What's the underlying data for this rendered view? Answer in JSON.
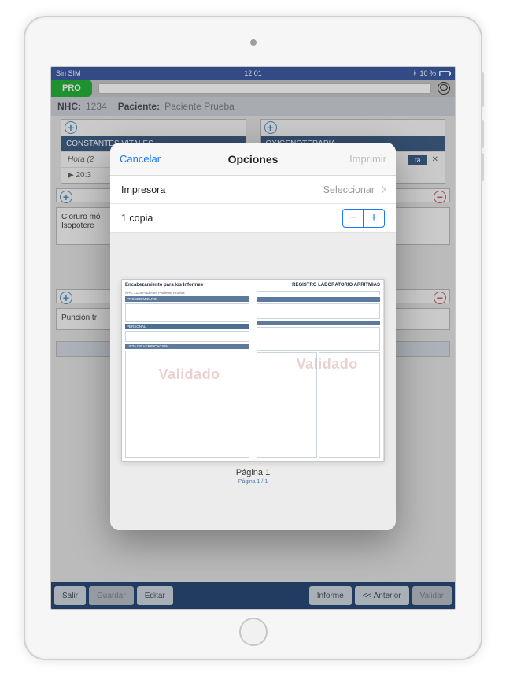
{
  "status": {
    "carrier": "Sin SIM",
    "time": "12:01",
    "battery_pct": "10 %"
  },
  "toolbar": {
    "pro": "PRO"
  },
  "patient": {
    "nhc_label": "NHC:",
    "nhc": "1234",
    "pac_label": "Paciente:",
    "pac": "Paciente Prueba"
  },
  "background": {
    "vitals_header": "CONSTANTES VITALES",
    "oxy_header": "OXIGENOTERAPIA",
    "hora_col": "Hora (2",
    "hora_val": "20:3",
    "med1": "Cloruro mó",
    "med2": "Isopotere",
    "puncion": "Punción tr",
    "tag": "ta"
  },
  "bottom": {
    "salir": "Salir",
    "guardar": "Guardar",
    "editar": "Editar",
    "informe": "Informe",
    "anterior": "<< Anterior",
    "validar": "Validar"
  },
  "sheet": {
    "cancel": "Cancelar",
    "title": "Opciones",
    "print": "Imprimir",
    "printer_label": "Impresora",
    "printer_value": "Seleccionar",
    "copies": "1 copia",
    "preview": {
      "left_title": "Encabezamiento para los Informes",
      "left_patient": "NHC   1234   Paciente: Paciente Prueba",
      "left_proc": "PROCEDIMIENTO",
      "left_personal": "PERSONAL",
      "left_lista": "LISTA DE VERIFICACIÓN",
      "right_title": "REGISTRO LABORATORIO ARRITMIAS",
      "watermark": "Validado",
      "page_caption": "Página 1",
      "page_footer": "Página 1 / 1"
    }
  }
}
